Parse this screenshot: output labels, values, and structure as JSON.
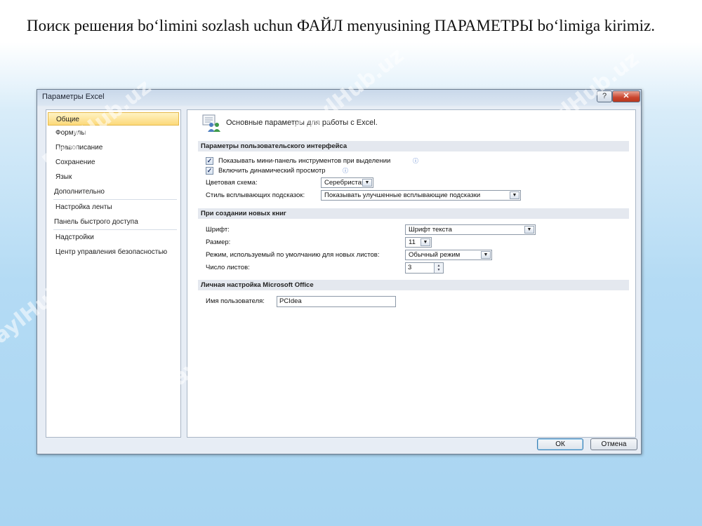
{
  "slide": {
    "text": "Поиск решения bo‘limini sozlash uchun ФАЙЛ menyusining ПАРАМЕТРЫ bo‘limiga kirimiz."
  },
  "watermark": {
    "text": "FaylHub.uz"
  },
  "dialog": {
    "title": "Параметры Excel",
    "help_label": "?",
    "close_label": "✕",
    "nav": [
      {
        "label": "Общие",
        "selected": true
      },
      {
        "label": "Формулы"
      },
      {
        "label": "Правописание"
      },
      {
        "label": "Сохранение"
      },
      {
        "label": "Язык"
      },
      {
        "label": "Дополнительно"
      },
      {
        "label": "Настройка ленты"
      },
      {
        "label": "Панель быстрого доступа"
      },
      {
        "label": "Надстройки"
      },
      {
        "label": "Центр управления безопасностью"
      }
    ],
    "header": {
      "text": "Основные параметры для работы с Excel.",
      "icon": "settings-people-icon"
    },
    "ui_section": {
      "title": "Параметры пользовательского интерфейса",
      "mini_toolbar": {
        "label": "Показывать мини-панель инструментов при выделении",
        "checked": true
      },
      "live_preview": {
        "label": "Включить динамический просмотр",
        "checked": true
      },
      "color_scheme": {
        "label": "Цветовая схема:",
        "value": "Серебристая"
      },
      "screentip_style": {
        "label": "Стиль всплывающих подсказок:",
        "value": "Показывать улучшенные всплывающие подсказки"
      }
    },
    "new_books_section": {
      "title": "При создании новых книг",
      "font": {
        "label": "Шрифт:",
        "value": "Шрифт текста"
      },
      "size": {
        "label": "Размер:",
        "value": "11"
      },
      "view_mode": {
        "label": "Режим, используемый по умолчанию для новых листов:",
        "value": "Обычный режим"
      },
      "sheet_count": {
        "label": "Число листов:",
        "value": "3"
      }
    },
    "personal_section": {
      "title": "Личная настройка Microsoft Office",
      "username": {
        "label": "Имя пользователя:",
        "value": "PCIdea"
      }
    },
    "ok_label": "ОК",
    "cancel_label": "Отмена"
  }
}
